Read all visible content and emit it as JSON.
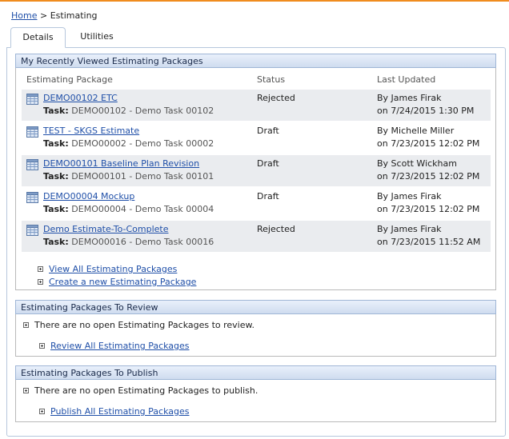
{
  "breadcrumb": {
    "home": "Home",
    "separator": ">",
    "current": "Estimating"
  },
  "tabs": [
    {
      "label": "Details"
    },
    {
      "label": "Utilities"
    }
  ],
  "recent": {
    "title": "My Recently Viewed Estimating Packages",
    "columns": {
      "package": "Estimating Package",
      "status": "Status",
      "updated": "Last Updated"
    },
    "task_prefix": "Task:",
    "rows": [
      {
        "name": "DEMO00102 ETC",
        "task": "DEMO00102 - Demo Task 00102",
        "status": "Rejected",
        "by": "By James Firak",
        "on": "on 7/24/2015 1:30 PM"
      },
      {
        "name": "TEST - SKGS Estimate",
        "task": "DEMO00002 - Demo Task 00002",
        "status": "Draft",
        "by": "By Michelle Miller",
        "on": "on 7/23/2015 12:02 PM"
      },
      {
        "name": "DEMO00101 Baseline Plan Revision",
        "task": "DEMO00101 - Demo Task 00101",
        "status": "Draft",
        "by": "By Scott Wickham",
        "on": "on 7/23/2015 12:02 PM"
      },
      {
        "name": "DEMO00004 Mockup",
        "task": "DEMO00004 - Demo Task 00004",
        "status": "Draft",
        "by": "By James Firak",
        "on": "on 7/23/2015 12:02 PM"
      },
      {
        "name": "Demo Estimate-To-Complete",
        "task": "DEMO00016 - Demo Task 00016",
        "status": "Rejected",
        "by": "By James Firak",
        "on": "on 7/23/2015 11:52 AM"
      }
    ],
    "links": {
      "view_all": "View All Estimating Packages",
      "create_new": "Create a new Estimating Package"
    }
  },
  "review": {
    "title": "Estimating Packages To Review",
    "message": "There are no open Estimating Packages to review.",
    "link": "Review All Estimating Packages"
  },
  "publish": {
    "title": "Estimating Packages To Publish",
    "message": "There are no open Estimating Packages to publish.",
    "link": "Publish All Estimating Packages"
  },
  "colors": {
    "accent_orange": "#f08c1e",
    "link_blue": "#1f4fa8",
    "header_blue": "#cfdcef",
    "row_shade": "#eaecef"
  },
  "icons": {
    "package": "estimating-package-icon",
    "expand": "plus-box-icon"
  }
}
